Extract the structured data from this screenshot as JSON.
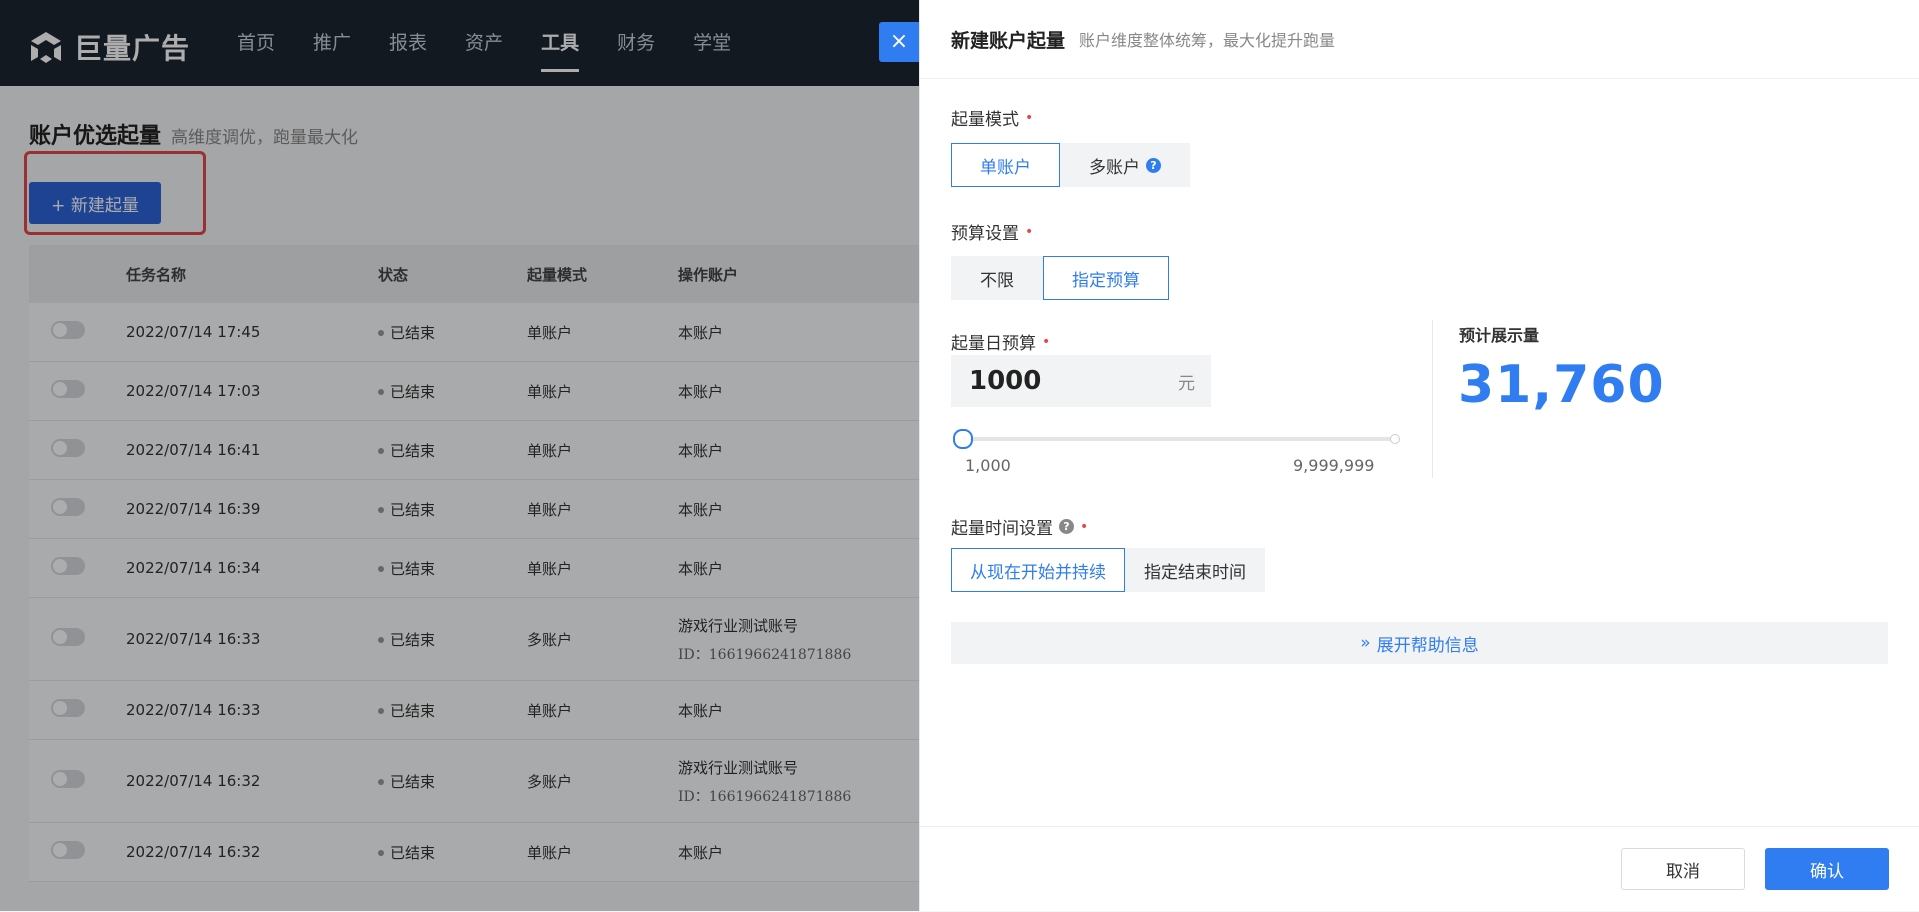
{
  "app": {
    "logo_text": "巨量广告",
    "nav": [
      "首页",
      "推广",
      "报表",
      "资产",
      "工具",
      "财务",
      "学堂"
    ],
    "nav_active": "工具"
  },
  "page": {
    "title": "账户优选起量",
    "subtitle": "高维度调优，跑量最大化",
    "new_button": "+ 新建起量"
  },
  "table": {
    "columns": [
      "任务名称",
      "状态",
      "起量模式",
      "操作账户"
    ],
    "rows": [
      {
        "name": "2022/07/14 17:45",
        "status": "已结束",
        "mode": "单账户",
        "account": "本账户",
        "account_id": ""
      },
      {
        "name": "2022/07/14 17:03",
        "status": "已结束",
        "mode": "单账户",
        "account": "本账户",
        "account_id": ""
      },
      {
        "name": "2022/07/14 16:41",
        "status": "已结束",
        "mode": "单账户",
        "account": "本账户",
        "account_id": ""
      },
      {
        "name": "2022/07/14 16:39",
        "status": "已结束",
        "mode": "单账户",
        "account": "本账户",
        "account_id": ""
      },
      {
        "name": "2022/07/14 16:34",
        "status": "已结束",
        "mode": "单账户",
        "account": "本账户",
        "account_id": ""
      },
      {
        "name": "2022/07/14 16:33",
        "status": "已结束",
        "mode": "多账户",
        "account": "游戏行业测试账号",
        "account_id": "ID：1661966241871886"
      },
      {
        "name": "2022/07/14 16:33",
        "status": "已结束",
        "mode": "单账户",
        "account": "本账户",
        "account_id": ""
      },
      {
        "name": "2022/07/14 16:32",
        "status": "已结束",
        "mode": "多账户",
        "account": "游戏行业测试账号",
        "account_id": "ID：1661966241871886"
      },
      {
        "name": "2022/07/14 16:32",
        "status": "已结束",
        "mode": "单账户",
        "account": "本账户",
        "account_id": ""
      }
    ]
  },
  "drawer": {
    "close_label": "×",
    "title": "新建账户起量",
    "subtitle": "账户维度整体统筹，最大化提升跑量",
    "mode_label": "起量模式",
    "mode_options": [
      "单账户",
      "多账户"
    ],
    "mode_selected": "单账户",
    "budget_label": "预算设置",
    "budget_options": [
      "不限",
      "指定预算"
    ],
    "budget_selected": "指定预算",
    "daily_label": "起量日预算",
    "daily_value": "1000",
    "daily_unit": "元",
    "slider_min": "1,000",
    "slider_max": "9,999,999",
    "slider_fraction": 0.0,
    "estimate_label": "预计展示量",
    "estimate_value": "31,760",
    "time_label": "起量时间设置",
    "time_options": [
      "从现在开始并持续",
      "指定结束时间"
    ],
    "time_selected": "从现在开始并持续",
    "expand_label": "展开帮助信息",
    "cancel_label": "取消",
    "confirm_label": "确认"
  }
}
